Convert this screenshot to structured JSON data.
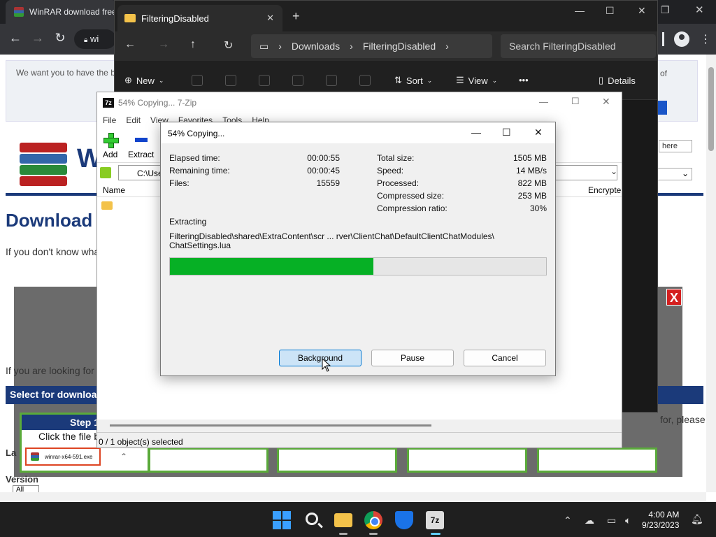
{
  "browser": {
    "tab_title": "WinRAR download free",
    "address": "wi",
    "cookie_text": "We want you to have the best browsing experience. We use cookies. For more details please see our privacy statement. Your browser, please adjust",
    "logo_text": "WinRAR",
    "page_heading": "Download",
    "page_para": "If you don't know wha",
    "looking_text": "If you are looking for",
    "select_bar": "Select for downloa",
    "step_title": "Step 1",
    "step_text": "Click the file b",
    "download_file": "winrar-x64-591.exe",
    "frag_of": "of",
    "frag_please": "for, please",
    "lang_label": "La",
    "version_label": "Version",
    "all_option": "All",
    "here_placeholder": "here",
    "overlay_close": "X"
  },
  "explorer": {
    "tab_title": "FilteringDisabled",
    "breadcrumb": [
      "Downloads",
      "FilteringDisabled"
    ],
    "search_placeholder": "Search FilteringDisabled",
    "toolbar": {
      "new": "New",
      "sort": "Sort",
      "view": "View",
      "more": "•••",
      "details": "Details"
    }
  },
  "zip_main": {
    "title": "54% Copying... 7-Zip",
    "menu": [
      "File",
      "Edit",
      "View",
      "Favorites",
      "Tools",
      "Help"
    ],
    "add_label": "Add",
    "extract_label": "Extract",
    "path": "C:\\Use",
    "col_name": "Name",
    "col_encrypted": "Encrypte",
    "status": "0 / 1 object(s) selected"
  },
  "progress_dialog": {
    "title": "54% Copying...",
    "elapsed_label": "Elapsed time:",
    "elapsed_value": "00:00:55",
    "remaining_label": "Remaining time:",
    "remaining_value": "00:00:45",
    "files_label": "Files:",
    "files_value": "15559",
    "total_label": "Total size:",
    "total_value": "1505 MB",
    "speed_label": "Speed:",
    "speed_value": "14 MB/s",
    "processed_label": "Processed:",
    "processed_value": "822 MB",
    "compressed_label": "Compressed size:",
    "compressed_value": "253 MB",
    "ratio_label": "Compression ratio:",
    "ratio_value": "30%",
    "operation": "Extracting",
    "current_file_line1": "FilteringDisabled\\shared\\ExtraContent\\scr ... rver\\ClientChat\\DefaultClientChatModules\\",
    "current_file_line2": "ChatSettings.lua",
    "progress_fraction": 0.54,
    "progress_color": "#06b025",
    "buttons": {
      "background": "Background",
      "pause": "Pause",
      "cancel": "Cancel"
    }
  },
  "taskbar": {
    "apps": [
      "start-icon",
      "search-icon",
      "file-explorer-icon",
      "chrome-icon",
      "defender-icon",
      "7zip-icon"
    ],
    "seven_zip": "7z",
    "time": "4:00 AM",
    "date": "9/23/2023"
  }
}
